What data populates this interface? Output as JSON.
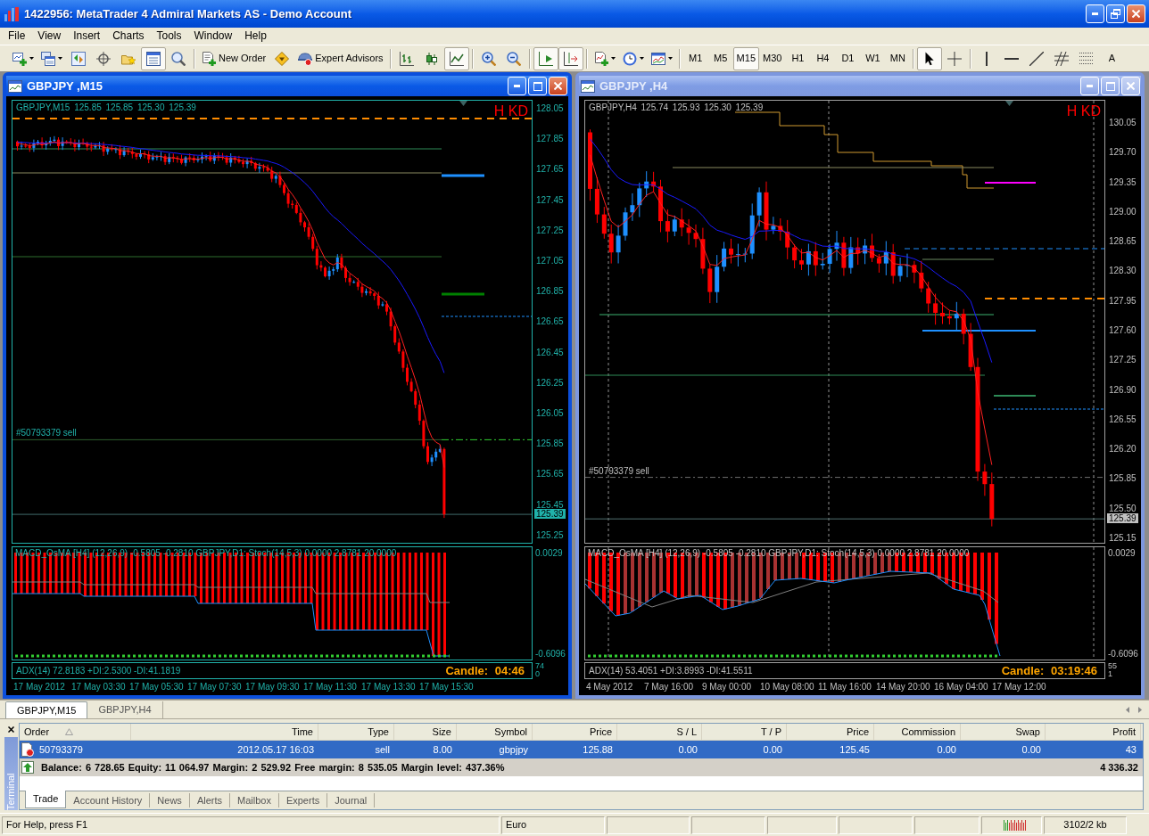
{
  "window": {
    "title": "1422956: MetaTrader 4 Admiral Markets AS - Demo Account"
  },
  "menu": [
    "File",
    "View",
    "Insert",
    "Charts",
    "Tools",
    "Window",
    "Help"
  ],
  "toolbar": {
    "groups": [
      {
        "items": [
          {
            "kind": "dropdown",
            "selected": false
          },
          {
            "kind": "dropdown",
            "selected": false
          },
          {
            "kind": "icon",
            "selected": false
          },
          {
            "kind": "icon",
            "selected": false
          },
          {
            "kind": "icon",
            "selected": false
          },
          {
            "kind": "icon",
            "selected": true
          },
          {
            "kind": "icon",
            "selected": false
          }
        ]
      },
      {
        "items": [
          {
            "kind": "labeled",
            "label": "New Order",
            "selected": false
          },
          {
            "kind": "icon",
            "selected": false
          },
          {
            "kind": "labeled",
            "label": "Expert Advisors",
            "selected": false
          }
        ]
      },
      {
        "items": [
          {
            "kind": "icon",
            "selected": false
          },
          {
            "kind": "icon",
            "selected": false
          },
          {
            "kind": "icon",
            "selected": true
          }
        ]
      },
      {
        "items": [
          {
            "kind": "icon",
            "selected": false
          },
          {
            "kind": "icon",
            "selected": false
          }
        ]
      },
      {
        "items": [
          {
            "kind": "icon",
            "selected": true
          },
          {
            "kind": "icon",
            "selected": true
          }
        ]
      },
      {
        "items": [
          {
            "kind": "dropdown",
            "selected": false
          },
          {
            "kind": "dropdown",
            "selected": false
          },
          {
            "kind": "dropdown",
            "selected": false
          }
        ]
      },
      {
        "items": [
          {
            "kind": "text",
            "label": "M1",
            "selected": false
          },
          {
            "kind": "text",
            "label": "M5",
            "selected": false
          },
          {
            "kind": "text",
            "label": "M15",
            "selected": true
          },
          {
            "kind": "text",
            "label": "M30",
            "selected": false
          },
          {
            "kind": "text",
            "label": "H1",
            "selected": false
          },
          {
            "kind": "text",
            "label": "H4",
            "selected": false
          },
          {
            "kind": "text",
            "label": "D1",
            "selected": false
          },
          {
            "kind": "text",
            "label": "W1",
            "selected": false
          },
          {
            "kind": "text",
            "label": "MN",
            "selected": false
          }
        ]
      },
      {
        "items": [
          {
            "kind": "icon",
            "selected": true
          },
          {
            "kind": "icon",
            "selected": false
          }
        ]
      },
      {
        "items": [
          {
            "kind": "icon",
            "selected": false
          },
          {
            "kind": "icon",
            "selected": false
          },
          {
            "kind": "icon",
            "selected": false
          },
          {
            "kind": "icon",
            "selected": false
          },
          {
            "kind": "icon",
            "selected": false
          },
          {
            "kind": "text",
            "label": "A",
            "selected": false
          }
        ]
      }
    ]
  },
  "charts": [
    {
      "title": "GBPJPY ,M15",
      "active": true,
      "header": "GBPJPY,M15 125.85 125.85 125.30 125.39",
      "mark": "H KD",
      "order_label": "#50793379 sell",
      "price_ticks": [
        "128.05",
        "127.85",
        "127.65",
        "127.45",
        "127.25",
        "127.05",
        "126.85",
        "126.65",
        "126.45",
        "126.25",
        "126.05",
        "125.85",
        "125.65",
        "125.45",
        "125.25"
      ],
      "last_price": "125.39",
      "macd_label": "MACD_OsMA [H4] (12,26,9) -0.5805 -0.2810 GBPJPY,D1: Stoch(14,5,3) 0.0000 2.8781 20.0000",
      "macd_ticks": [
        "0.0029",
        "-0.6096"
      ],
      "adx_label": "ADX(14) 72.8183 +DI:2.5300 -DI:41.1819",
      "candle_timer": "Candle: 04:46",
      "adx_ticks": [
        "74",
        "0"
      ],
      "time_labels": [
        "17 May 2012",
        "17 May 03:30",
        "17 May 05:30",
        "17 May 07:30",
        "17 May 09:30",
        "17 May 11:30",
        "17 May 13:30",
        "17 May 15:30"
      ]
    },
    {
      "title": "GBPJPY ,H4",
      "active": false,
      "header": "GBPJPY,H4 125.74 125.93 125.30 125.39",
      "mark": "H KD",
      "order_label": "#50793379 sell",
      "price_ticks": [
        "130.05",
        "129.70",
        "129.35",
        "129.00",
        "128.65",
        "128.30",
        "127.95",
        "127.60",
        "127.25",
        "126.90",
        "126.55",
        "126.20",
        "125.85",
        "125.50",
        "125.15"
      ],
      "last_price": "125.39",
      "macd_label": "MACD_OsMA [H4] (12,26,9) -0.5805 -0.2810 GBPJPY,D1: Stoch(14,5,3) 0.0000 2.8781 20.0000",
      "macd_ticks": [
        "0.0029",
        "-0.6096"
      ],
      "adx_label": "ADX(14) 53.4051 +DI:3.8993 -DI:41.5511",
      "candle_timer": "Candle: 03:19:46",
      "adx_ticks": [
        "55",
        "1"
      ],
      "time_labels": [
        "4 May 2012",
        "7 May 16:00",
        "9 May 00:00",
        "10 May 08:00",
        "11 May 16:00",
        "14 May 20:00",
        "16 May 04:00",
        "17 May 12:00"
      ]
    }
  ],
  "chart_tabs": [
    {
      "label": "GBPJPY,M15",
      "selected": true
    },
    {
      "label": "GBPJPY,H4",
      "selected": false
    }
  ],
  "terminal": {
    "label": "Terminal",
    "columns": [
      "Order",
      "Time",
      "Type",
      "Size",
      "Symbol",
      "Price",
      "S / L",
      "T / P",
      "Price",
      "Commission",
      "Swap",
      "Profit"
    ],
    "rows": [
      {
        "cells": [
          "50793379",
          "2012.05.17 16:03",
          "sell",
          "8.00",
          "gbpjpy",
          "125.88",
          "0.00",
          "0.00",
          "125.45",
          "0.00",
          "0.00",
          "43"
        ],
        "selected": true
      }
    ],
    "summary": {
      "text": "Balance: 6 728.65 Equity: 11 064.97 Margin: 2 529.92 Free margin: 8 535.05 Margin level: 437.36%",
      "profit": "4 336.32"
    },
    "tabs": [
      {
        "label": "Trade",
        "selected": true
      },
      {
        "label": "Account History",
        "selected": false
      },
      {
        "label": "News",
        "selected": false
      },
      {
        "label": "Alerts",
        "selected": false
      },
      {
        "label": "Mailbox",
        "selected": false
      },
      {
        "label": "Experts",
        "selected": false
      },
      {
        "label": "Journal",
        "selected": false
      }
    ]
  },
  "status_bar": {
    "help": "For Help, press F1",
    "profile": "Euro",
    "traffic": "3102/2 kb"
  }
}
